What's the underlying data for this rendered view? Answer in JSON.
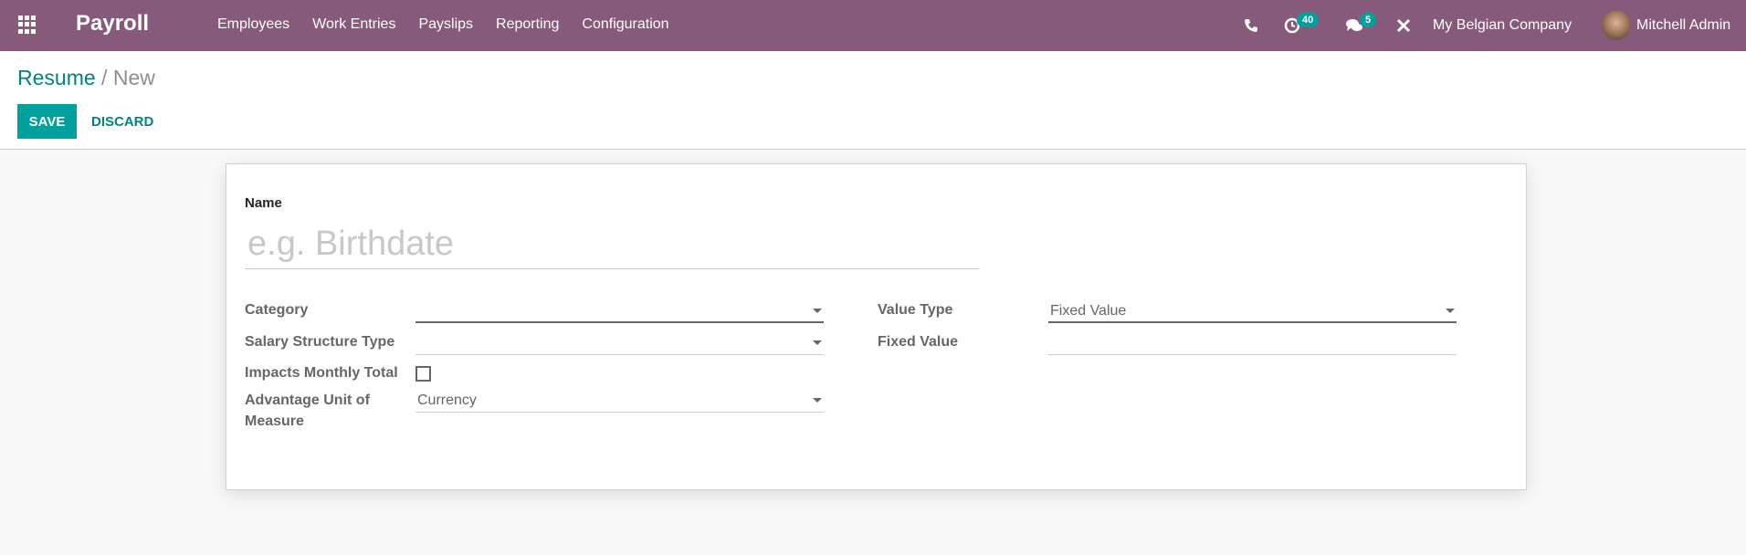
{
  "navbar": {
    "app_name": "Payroll",
    "menu": [
      "Employees",
      "Work Entries",
      "Payslips",
      "Reporting",
      "Configuration"
    ],
    "activity_count": "40",
    "messages_count": "5",
    "company": "My Belgian Company",
    "user": "Mitchell Admin",
    "icons": [
      "apps-grid-icon",
      "phone-icon",
      "clock-activity-icon",
      "chat-icon",
      "tools-icon"
    ],
    "color": "#875a7b"
  },
  "control_panel": {
    "breadcrumb_parent": "Resume",
    "breadcrumb_sep": "/",
    "breadcrumb_current": "New",
    "save_label": "SAVE",
    "discard_label": "DISCARD"
  },
  "form": {
    "name_label": "Name",
    "name_placeholder": "e.g. Birthdate",
    "name_value": "",
    "left": {
      "category_label": "Category",
      "category_value": "",
      "structure_type_label": "Salary Structure Type",
      "structure_type_value": "",
      "impacts_label": "Impacts Monthly Total",
      "impacts_checked": false,
      "uom_label_1": "Advantage Unit of",
      "uom_label_2": "Measure",
      "uom_value": "Currency"
    },
    "right": {
      "value_type_label": "Value Type",
      "value_type_value": "Fixed Value",
      "fixed_value_label": "Fixed Value",
      "fixed_value_value": ""
    }
  },
  "colors": {
    "accent": "#00a09d",
    "link": "#00847e"
  }
}
